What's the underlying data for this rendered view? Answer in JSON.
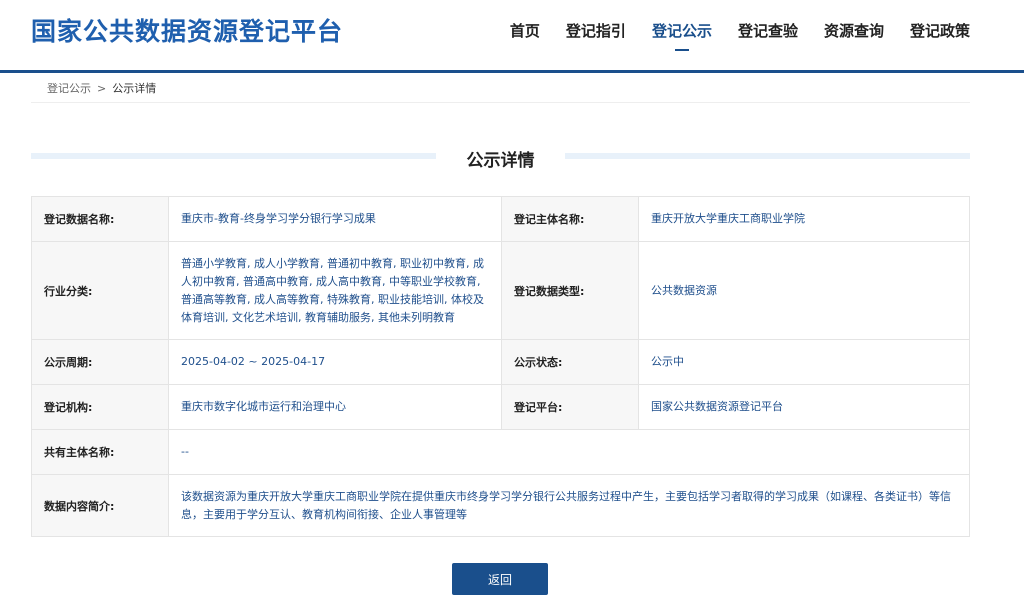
{
  "header": {
    "site_title": "国家公共数据资源登记平台",
    "nav": [
      {
        "label": "首页"
      },
      {
        "label": "登记指引"
      },
      {
        "label": "登记公示"
      },
      {
        "label": "登记查验"
      },
      {
        "label": "资源查询"
      },
      {
        "label": "登记政策"
      }
    ],
    "active_nav": "登记公示"
  },
  "breadcrumb": {
    "parent": "登记公示",
    "separator": ">",
    "current": "公示详情"
  },
  "page_title": "公示详情",
  "detail": {
    "data_name_label": "登记数据名称:",
    "data_name": "重庆市-教育-终身学习学分银行学习成果",
    "subject_label": "登记主体名称:",
    "subject": "重庆开放大学重庆工商职业学院",
    "industry_label": "行业分类:",
    "industry": "普通小学教育, 成人小学教育, 普通初中教育, 职业初中教育, 成人初中教育, 普通高中教育, 成人高中教育, 中等职业学校教育, 普通高等教育, 成人高等教育, 特殊教育, 职业技能培训, 体校及体育培训, 文化艺术培训, 教育辅助服务, 其他未列明教育",
    "data_type_label": "登记数据类型:",
    "data_type": "公共数据资源",
    "period_label": "公示周期:",
    "period": "2025-04-02 ~ 2025-04-17",
    "status_label": "公示状态:",
    "status": "公示中",
    "org_label": "登记机构:",
    "org": "重庆市数字化城市运行和治理中心",
    "platform_label": "登记平台:",
    "platform": "国家公共数据资源登记平台",
    "co_owner_label": "共有主体名称:",
    "co_owner": "--",
    "summary_label": "数据内容简介:",
    "summary": "该数据资源为重庆开放大学重庆工商职业学院在提供重庆市终身学习学分银行公共服务过程中产生，主要包括学习者取得的学习成果（如课程、各类证书）等信息，主要用于学分互认、教育机构间衔接、企业人事管理等"
  },
  "back_button": "返回",
  "colors": {
    "primary": "#1a4f8c",
    "logo": "#1f5fae",
    "value_text": "#1f4f8c"
  }
}
